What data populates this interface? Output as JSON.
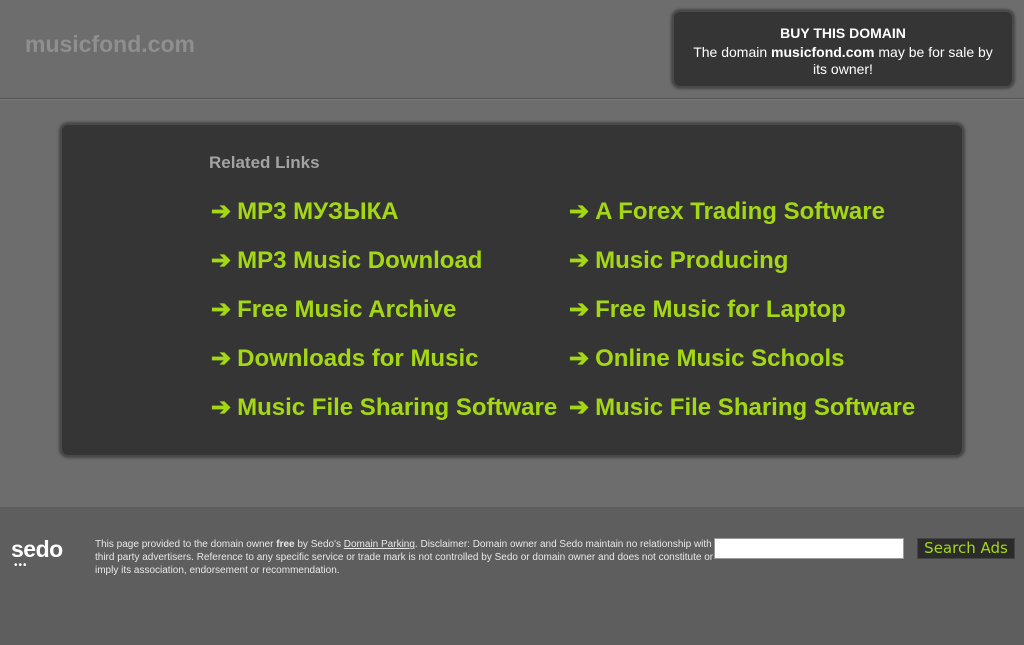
{
  "header": {
    "site_title": "musicfond.com"
  },
  "buy_box": {
    "title": "BUY THIS DOMAIN",
    "text_prefix": "The domain ",
    "domain": "musicfond.com",
    "text_suffix": " may be for sale by its owner!"
  },
  "related": {
    "title": "Related Links",
    "arrow": "➔",
    "left_links": [
      {
        "label": "MP3 МУЗЫКА"
      },
      {
        "label": "MP3 Music Download"
      },
      {
        "label": "Free Music Archive"
      },
      {
        "label": "Downloads for Music"
      },
      {
        "label": "Music File Sharing Software"
      }
    ],
    "right_links": [
      {
        "label": "A Forex Trading Software"
      },
      {
        "label": "Music Producing"
      },
      {
        "label": "Free Music for Laptop"
      },
      {
        "label": "Online Music Schools"
      },
      {
        "label": "Music File Sharing Software"
      }
    ]
  },
  "footer": {
    "logo": "sedo",
    "logo_dots": "•••",
    "disclaimer_1": "This page provided to the domain owner ",
    "disclaimer_free": "free",
    "disclaimer_2": " by Sedo's ",
    "disclaimer_link": "Domain Parking",
    "disclaimer_3": ". Disclaimer: Domain owner and Sedo maintain no relationship with third party advertisers. Reference to any specific service or trade mark is not controlled by Sedo or domain owner and does not constitute or imply its association, endorsement or recommendation.",
    "search_value": "",
    "search_button": "Search Ads"
  },
  "colors": {
    "background": "#6d6d6d",
    "panel": "#353535",
    "link": "#a4d815"
  }
}
